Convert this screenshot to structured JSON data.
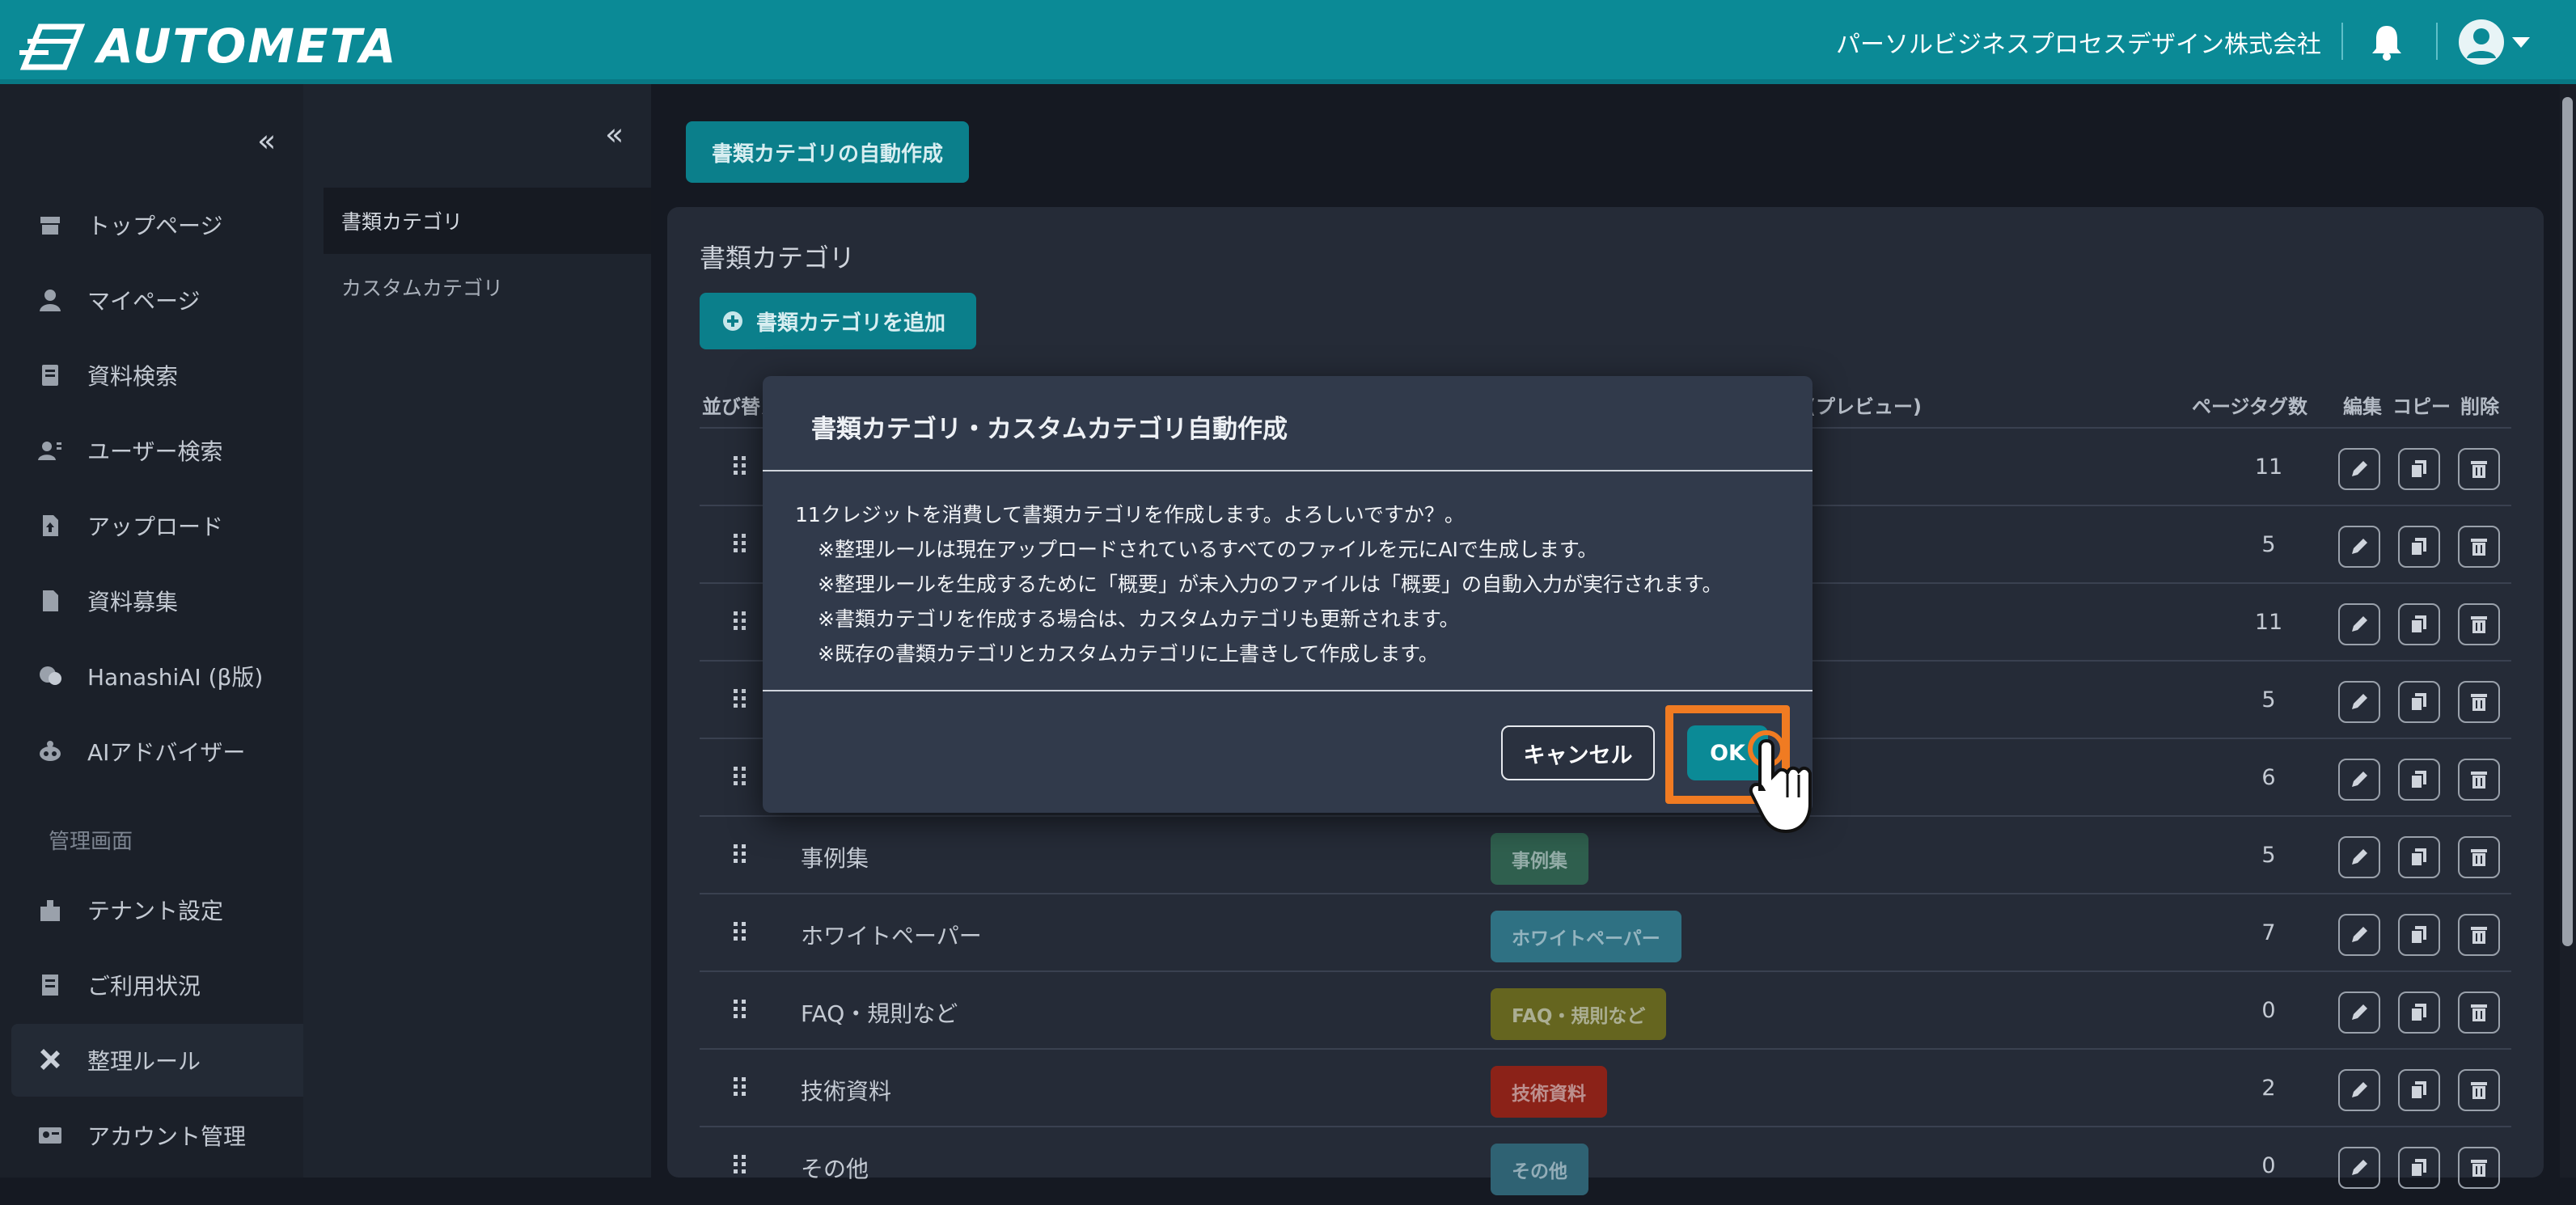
{
  "header": {
    "logo_text": "AUTOMETA",
    "company": "パーソルビジネスプロセスデザイン株式会社",
    "brand_color": "#0b8a96"
  },
  "sidebar": {
    "collapse": "«",
    "items": [
      {
        "label": "トップページ",
        "icon": "store-icon"
      },
      {
        "label": "マイページ",
        "icon": "user-icon"
      },
      {
        "label": "資料検索",
        "icon": "document-search-icon"
      },
      {
        "label": "ユーザー検索",
        "icon": "user-search-icon"
      },
      {
        "label": "アップロード",
        "icon": "upload-file-icon"
      },
      {
        "label": "資料募集",
        "icon": "file-icon"
      },
      {
        "label": "HanashiAI (β版)",
        "icon": "chat-icon"
      },
      {
        "label": "AIアドバイザー",
        "icon": "robot-icon"
      }
    ],
    "admin_section": "管理画面",
    "admin_items": [
      {
        "label": "テナント設定",
        "icon": "building-icon"
      },
      {
        "label": "ご利用状況",
        "icon": "receipt-icon"
      },
      {
        "label": "整理ルール",
        "icon": "tools-icon"
      },
      {
        "label": "アカウント管理",
        "icon": "id-card-icon"
      }
    ]
  },
  "subnav": {
    "collapse": "«",
    "items": [
      "書類カテゴリ",
      "カスタムカテゴリ"
    ]
  },
  "main": {
    "auto_button": "書類カテゴリの自動作成",
    "panel_title": "書類カテゴリ",
    "add_button": "書類カテゴリを追加",
    "columns": {
      "sort": "並び替え",
      "preview": "(プレビュー)",
      "tags": "ページタグ数",
      "edit": "編集",
      "copy": "コピー",
      "delete": "削除"
    },
    "rows": [
      {
        "name": "",
        "tag": "",
        "tag_color": "",
        "count": "11"
      },
      {
        "name": "",
        "tag": "",
        "tag_color": "",
        "count": "5"
      },
      {
        "name": "",
        "tag": "",
        "tag_color": "",
        "count": "11"
      },
      {
        "name": "",
        "tag": "",
        "tag_color": "",
        "count": "5"
      },
      {
        "name": "",
        "tag": "",
        "tag_color": "",
        "count": "6"
      },
      {
        "name": "事例集",
        "tag": "事例集",
        "tag_color": "#2f5f4e",
        "count": "5"
      },
      {
        "name": "ホワイトペーパー",
        "tag": "ホワイトペーパー",
        "tag_color": "#2f7183",
        "count": "7"
      },
      {
        "name": "FAQ・規則など",
        "tag": "FAQ・規則など",
        "tag_color": "#65651f",
        "count": "0"
      },
      {
        "name": "技術資料",
        "tag": "技術資料",
        "tag_color": "#8b2218",
        "count": "2"
      },
      {
        "name": "その他",
        "tag": "その他",
        "tag_color": "#2f6273",
        "count": "0"
      }
    ]
  },
  "modal": {
    "title": "書類カテゴリ・カスタムカテゴリ自動作成",
    "line1": "11クレジットを消費して書類カテゴリを作成します。よろしいですか？。",
    "line2": "※整理ルールは現在アップロードされているすべてのファイルを元にAIで生成します。",
    "line3": "※整理ルールを生成するために「概要」が未入力のファイルは「概要」の自動入力が実行されます。",
    "line4": "※書類カテゴリを作成する場合は、カスタムカテゴリも更新されます。",
    "line5": "※既存の書類カテゴリとカスタムカテゴリに上書きして作成します。",
    "cancel": "キャンセル",
    "ok": "OK",
    "highlight_color": "#f07b22"
  }
}
